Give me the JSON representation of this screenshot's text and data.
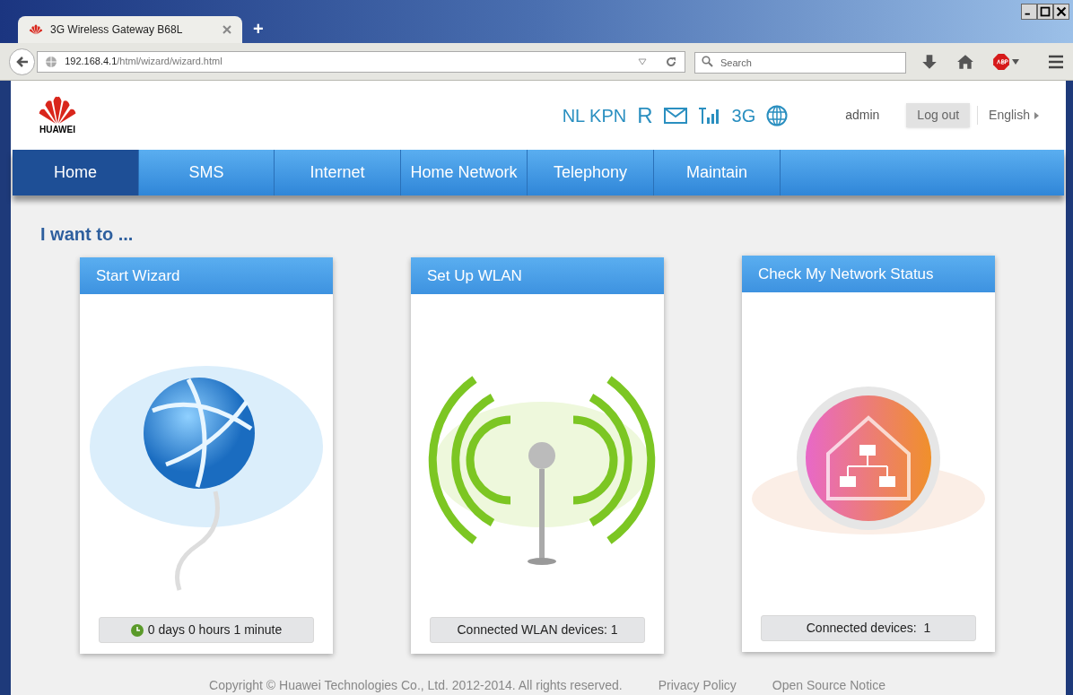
{
  "browser": {
    "tab_title": "3G Wireless Gateway B68L",
    "new_tab": "+",
    "url_host": "192.168.4.1",
    "url_path": "/html/wizard/wizard.html",
    "search": {
      "placeholder": "Search"
    }
  },
  "header": {
    "logo_text": "HUAWEI",
    "operator": "NL KPN",
    "roaming": "R",
    "network_type": "3G",
    "user": "admin",
    "logout": "Log out",
    "language": "English"
  },
  "nav": [
    {
      "label": "Home",
      "selected": true
    },
    {
      "label": "SMS",
      "selected": false
    },
    {
      "label": "Internet",
      "selected": false
    },
    {
      "label": "Home Network",
      "selected": false
    },
    {
      "label": "Telephony",
      "selected": false
    },
    {
      "label": "Maintain",
      "selected": false
    }
  ],
  "heading": "I want to ...",
  "cards": [
    {
      "kind": "wizard",
      "title": "Start Wizard",
      "footer": "0 days 0 hours 1 minute"
    },
    {
      "kind": "wlan",
      "title": "Set Up WLAN",
      "footer": "Connected WLAN devices: 1"
    },
    {
      "kind": "network",
      "title": "Check My Network Status",
      "footer": "Connected devices:  1"
    }
  ],
  "footer": {
    "copyright": "Copyright © Huawei Technologies Co., Ltd. 2012-2014. All rights reserved.",
    "links": [
      "Privacy Policy",
      "Open Source Notice"
    ]
  }
}
